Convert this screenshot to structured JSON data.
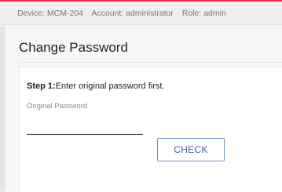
{
  "status_bar": {
    "device": "Device: MCM-204",
    "account": "Account: administrator",
    "role": "Role: admin"
  },
  "page": {
    "title": "Change Password"
  },
  "form": {
    "step_label": "Step 1:",
    "step_text": "Enter original password first.",
    "original_password_label": "Original Password",
    "original_password_value": "",
    "check_button_label": "CHECK"
  },
  "colors": {
    "accent": "#d9363e",
    "button_border": "#6f8fc0",
    "button_text": "#3f5f97"
  }
}
